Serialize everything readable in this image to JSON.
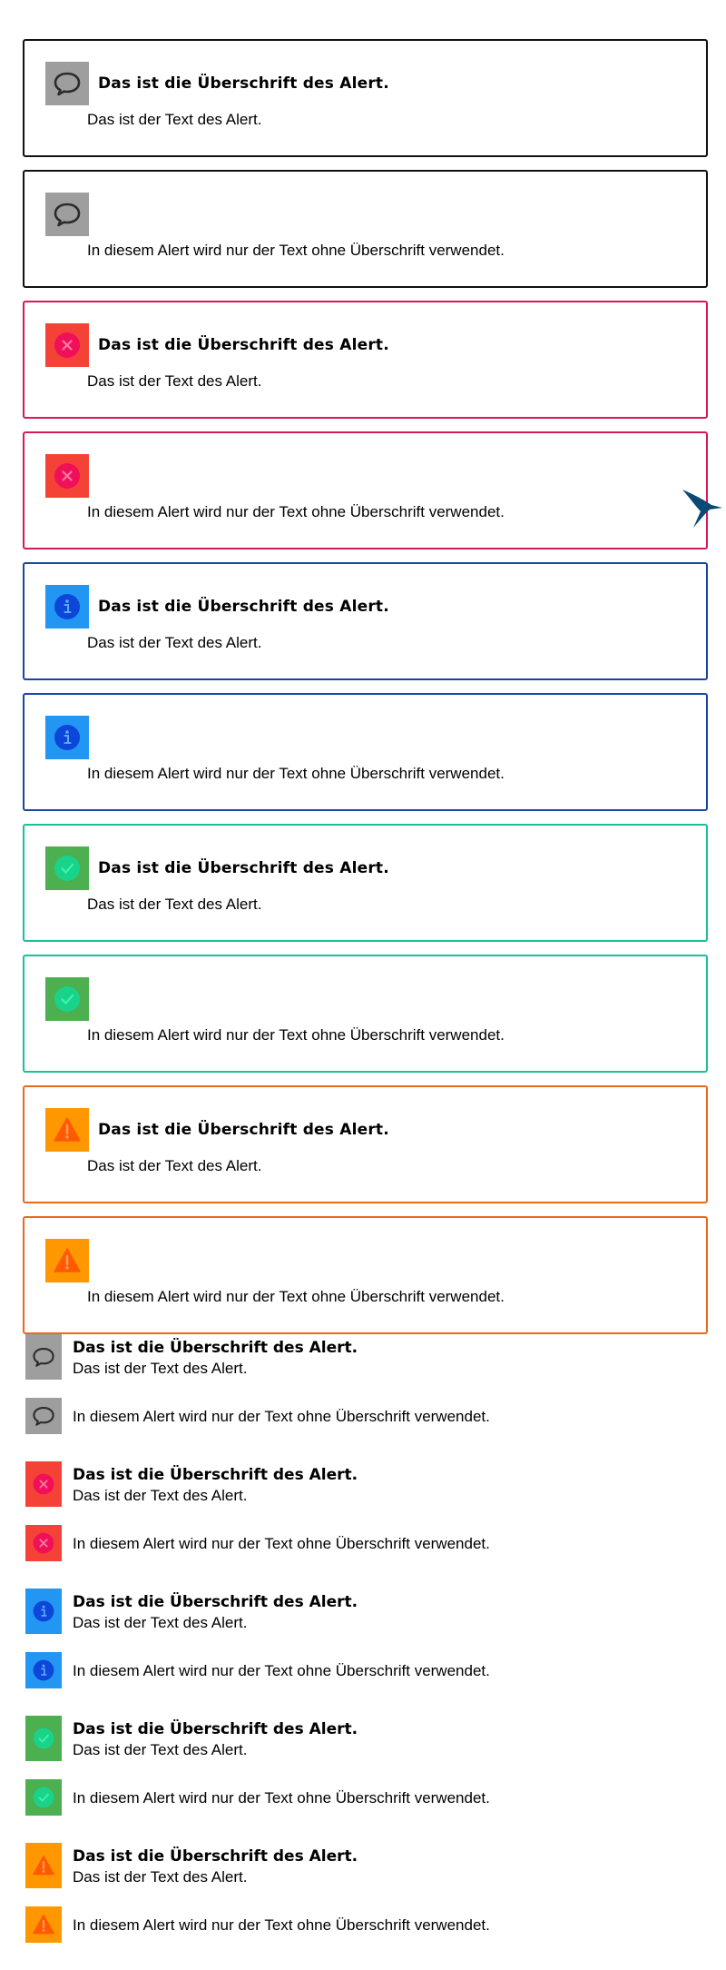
{
  "types": {
    "neutral": {
      "border": "#111111",
      "box": "#9e9e9e",
      "icon": "speech-bubble",
      "ink": "#2b2b2b"
    },
    "error": {
      "border": "#d6195b",
      "box": "#f44336",
      "icon": "circle-x",
      "ink": "#f0105a"
    },
    "info": {
      "border": "#1946a6",
      "box": "#2196f3",
      "icon": "circle-info",
      "ink": "#0d47d9"
    },
    "success": {
      "border": "#1bbf9a",
      "box": "#4caf50",
      "icon": "circle-check",
      "ink": "#19d38a"
    },
    "warning": {
      "border": "#e86a1d",
      "box": "#ff9800",
      "icon": "triangle-warning",
      "ink": "#ff5a00"
    }
  },
  "alerts": [
    {
      "type": "neutral",
      "title": "Das ist die Überschrift des Alert.",
      "text": "Das ist der Text des Alert."
    },
    {
      "type": "neutral",
      "text": "In diesem Alert wird nur der Text ohne Überschrift verwendet."
    },
    {
      "type": "error",
      "title": "Das ist die Überschrift des Alert.",
      "text": "Das ist der Text des Alert."
    },
    {
      "type": "error",
      "text": "In diesem Alert wird nur der Text ohne Überschrift verwendet."
    },
    {
      "type": "info",
      "title": "Das ist die Überschrift des Alert.",
      "text": "Das ist der Text des Alert."
    },
    {
      "type": "info",
      "text": "In diesem Alert wird nur der Text ohne Überschrift verwendet."
    },
    {
      "type": "success",
      "title": "Das ist die Überschrift des Alert.",
      "text": "Das ist der Text des Alert."
    },
    {
      "type": "success",
      "text": "In diesem Alert wird nur der Text ohne Überschrift verwendet."
    },
    {
      "type": "warning",
      "title": "Das ist die Überschrift des Alert.",
      "text": "Das ist der Text des Alert."
    },
    {
      "type": "warning",
      "text": "In diesem Alert wird nur der Text ohne Überschrift verwendet."
    }
  ],
  "compact_alerts": [
    {
      "type": "neutral",
      "title": "Das ist die Überschrift des Alert.",
      "text": "Das ist der Text des Alert."
    },
    {
      "type": "neutral",
      "text": "In diesem Alert wird nur der Text ohne Überschrift verwendet."
    },
    {
      "type": "error",
      "title": "Das ist die Überschrift des Alert.",
      "text": "Das ist der Text des Alert."
    },
    {
      "type": "error",
      "text": "In diesem Alert wird nur der Text ohne Überschrift verwendet."
    },
    {
      "type": "info",
      "title": "Das ist die Überschrift des Alert.",
      "text": "Das ist der Text des Alert."
    },
    {
      "type": "info",
      "text": "In diesem Alert wird nur der Text ohne Überschrift verwendet."
    },
    {
      "type": "success",
      "title": "Das ist die Überschrift des Alert.",
      "text": "Das ist der Text des Alert."
    },
    {
      "type": "success",
      "text": "In diesem Alert wird nur der Text ohne Überschrift verwendet."
    },
    {
      "type": "warning",
      "title": "Das ist die Überschrift des Alert.",
      "text": "Das ist der Text des Alert."
    },
    {
      "type": "warning",
      "text": "In diesem Alert wird nur der Text ohne Überschrift verwendet."
    }
  ],
  "floating": {
    "icon": "hummingbird",
    "color": "#0b4a74"
  }
}
